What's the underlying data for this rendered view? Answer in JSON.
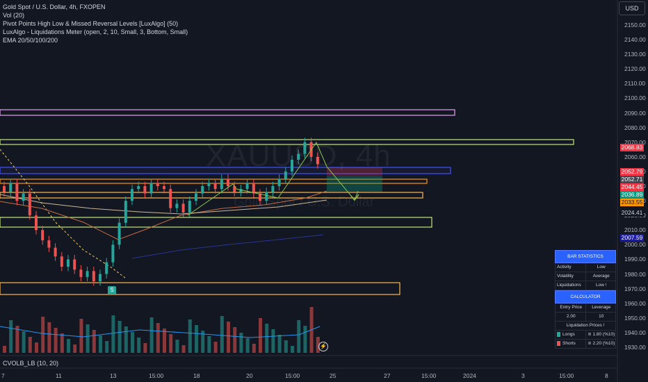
{
  "legend": {
    "symbol": "Gold Spot / U.S. Dollar, 4h, FXOPEN",
    "vol": "Vol (20)",
    "pivots": "Pivot Points High Low & Missed Reversal Levels [LuxAlgo] (50)",
    "liquidations": "LuxAlgo - Liquidations Meter (open, 2, 10, Small, 3, Bottom, Small)",
    "ema": "EMA 20/50/100/200"
  },
  "currency_button": "USD",
  "watermark": {
    "ticker": "XAUUSD, 4h",
    "name": "Gold Spot / U.S. Dollar"
  },
  "y_axis_labels": [
    "2150.00",
    "2140.00",
    "2130.00",
    "2120.00",
    "2110.00",
    "2100.00",
    "2090.00",
    "2080.00",
    "2070.00",
    "2060.00",
    "2050.00",
    "2040.00",
    "2030.00",
    "2020.00",
    "2010.00",
    "2000.00",
    "1990.00",
    "1980.00",
    "1970.00",
    "1960.00",
    "1950.00",
    "1940.00",
    "1930.00"
  ],
  "price_tags": [
    {
      "text": "2068.83",
      "bg": "#f23645",
      "fg": "#ffffff"
    },
    {
      "text": "2052.79",
      "bg": "#f23645",
      "fg": "#ffffff"
    },
    {
      "text": "2052.71",
      "bg": "#434651",
      "fg": "#ffffff"
    },
    {
      "text": "2044.45",
      "bg": "#f23645",
      "fg": "#ffffff"
    },
    {
      "text": "2036.89",
      "bg": "#089981",
      "fg": "#ffffff"
    },
    {
      "text": "2033.55",
      "bg": "#ff9800",
      "fg": "#131722"
    },
    {
      "text": "2024.41",
      "bg": "#131722",
      "fg": "#d1d4dc"
    },
    {
      "text": "2007.59",
      "bg": "#1a1aa6",
      "fg": "#ffffff"
    }
  ],
  "x_axis_labels": [
    "7",
    "11",
    "13",
    "15:00",
    "18",
    "20",
    "15:00",
    "25",
    "27",
    "15:00",
    "2024",
    "3",
    "15:00",
    "8"
  ],
  "cvol_label": "CVOLB_LB (10, 20)",
  "badge": "S",
  "bolt_icon": "⚡",
  "stats": {
    "bar_statistics": "BAR STATISTICS",
    "rows": [
      {
        "label": "Activity",
        "value": "Low"
      },
      {
        "label": "Volatility",
        "value": "Average"
      },
      {
        "label": "Liquidations",
        "value": "Low !"
      }
    ],
    "calculator": "CALCULATOR",
    "calc_headers": [
      "Entry Price",
      "Leverage"
    ],
    "calc_values": [
      "2.00",
      "10"
    ],
    "liq_prices_title": "Liquidation Prices !",
    "longs": {
      "label": "Longs",
      "value": "≅ 1.80 (%10)"
    },
    "shorts": {
      "label": "Shorts",
      "value": "≅ 2.20 (%10)"
    }
  },
  "colors": {
    "background": "#131722",
    "up": "#26a69a",
    "down": "#ef5350",
    "zone_orange": "#ffb74d",
    "zone_green": "#c6e77a",
    "zone_blue": "#3f51ff",
    "zone_pink": "#e6a0f0",
    "projection": "#8bc34a"
  },
  "chart_data": {
    "type": "candlestick",
    "y_range": [
      1930,
      2155
    ],
    "current_price": 2052.71
  }
}
